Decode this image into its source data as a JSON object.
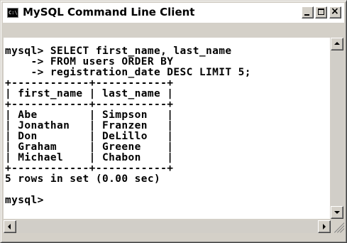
{
  "window": {
    "title": "MySQL Command Line Client",
    "icon_text": "C:\\>",
    "icons": {
      "app": "console-icon",
      "minimize": "minimize-icon",
      "maximize": "maximize-icon",
      "close": "close-icon"
    },
    "close_glyph": "×"
  },
  "console": {
    "lines": [
      "mysql> SELECT first_name, last_name",
      "    -> FROM users ORDER BY",
      "    -> registration_date DESC LIMIT 5;",
      "+------------+-----------+",
      "| first_name | last_name |",
      "+------------+-----------+",
      "| Abe        | Simpson   |",
      "| Jonathan   | Franzen   |",
      "| Don        | DeLillo   |",
      "| Graham     | Greene    |",
      "| Michael    | Chabon    |",
      "+------------+-----------+",
      "5 rows in set (0.00 sec)",
      "",
      "mysql>"
    ],
    "table": {
      "columns": [
        "first_name",
        "last_name"
      ],
      "rows": [
        [
          "Abe",
          "Simpson"
        ],
        [
          "Jonathan",
          "Franzen"
        ],
        [
          "Don",
          "DeLillo"
        ],
        [
          "Graham",
          "Greene"
        ],
        [
          "Michael",
          "Chabon"
        ]
      ]
    }
  },
  "scrollbars": {
    "icons": [
      "scroll-up-arrow",
      "scroll-down-arrow",
      "scroll-left-arrow",
      "scroll-right-arrow",
      "size-grip"
    ]
  }
}
